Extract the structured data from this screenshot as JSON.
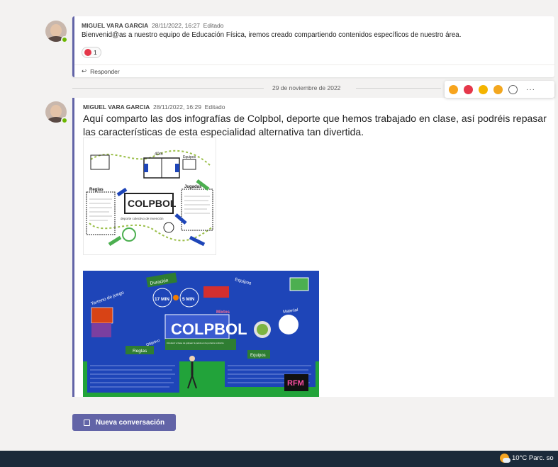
{
  "messages": [
    {
      "author": "MIGUEL VARA GARCIA",
      "timestamp": "28/11/2022, 16:27",
      "edited": "Editado",
      "text": "Bienvenid@as a nuestro equipo de Educación Física,  iremos  creado compartiendo contenidos específicos de nuestro área.",
      "reaction_count": "1",
      "reply_label": "Responder"
    },
    {
      "author": "MIGUEL VARA GARCIA",
      "timestamp": "28/11/2022, 16:29",
      "edited": "Editado",
      "text": "Aquí comparto las dos infografías de Colpbol, deporte que hemos trabajado en clase, así podréis repasar las características de esta especialidad alternativa tan divertida."
    }
  ],
  "date_separator": "29 de noviembre de 2022",
  "reaction_bar": {
    "icons": [
      "like-icon",
      "heart-icon",
      "laugh-icon",
      "surprised-icon",
      "add-reaction-icon"
    ],
    "colors": [
      "#f7a41d",
      "#e5374a",
      "#f4b400",
      "#f3a71f",
      "#616161"
    ],
    "more": "···"
  },
  "infographic1": {
    "title": "COLPBOL",
    "subtitle": "deporte colectivo de invención",
    "labels": [
      "40m",
      "Reglas",
      "Jugadas",
      "Equipos"
    ]
  },
  "infographic2": {
    "title": "COLPBOL",
    "subtitle": "introducir a base de golpear la pelota en la portería contraria",
    "labels": [
      "Duración",
      "Equipos",
      "Terreno de juego",
      "Material",
      "Reglas",
      "Objetivo",
      "Mixtos"
    ],
    "times": [
      "17 MIN",
      "5 MIN"
    ],
    "logo": "RFM"
  },
  "new_conversation_label": "Nueva conversación",
  "taskbar": {
    "weather": "10°C  Parc. so"
  }
}
